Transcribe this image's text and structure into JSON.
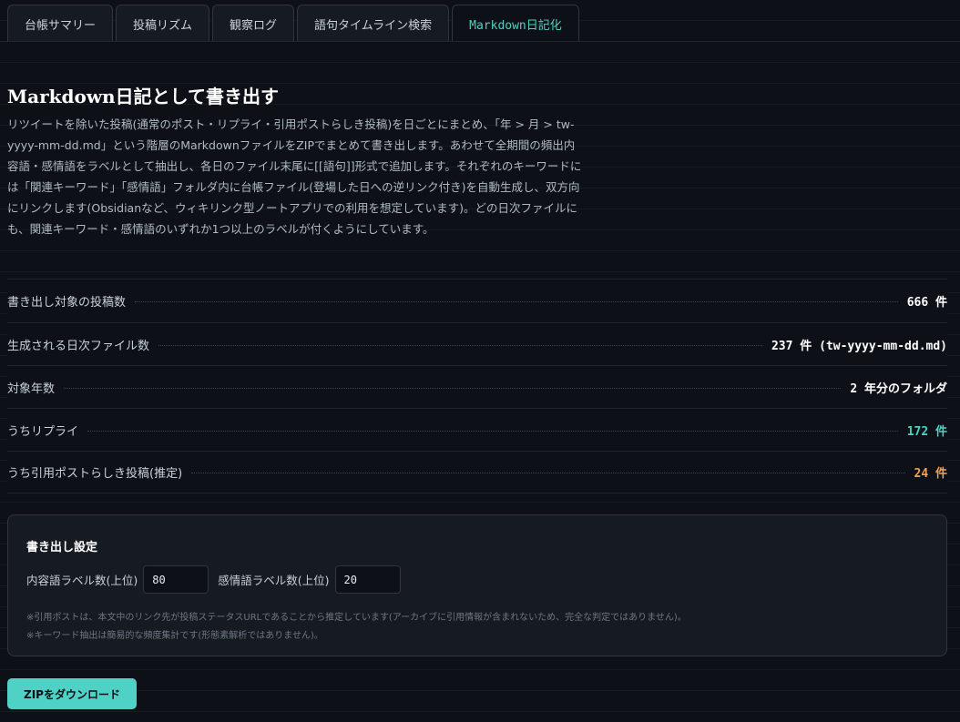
{
  "tabs": [
    {
      "label": "台帳サマリー"
    },
    {
      "label": "投稿リズム"
    },
    {
      "label": "観察ログ"
    },
    {
      "label": "語句タイムライン検索"
    },
    {
      "label": "Markdown日記化"
    }
  ],
  "active_tab": 4,
  "main": {
    "title": "Markdown日記として書き出す",
    "description": "リツイートを除いた投稿(通常のポスト・リプライ・引用ポストらしき投稿)を日ごとにまとめ、「年 > 月 > tw-yyyy-mm-dd.md」という階層のMarkdownファイルをZIPでまとめて書き出します。あわせて全期間の頻出内容語・感情語をラベルとして抽出し、各日のファイル末尾に[[語句]]形式で追加します。それぞれのキーワードには「関連キーワード」「感情語」フォルダ内に台帳ファイル(登場した日への逆リンク付き)を自動生成し、双方向にリンクします(Obsidianなど、ウィキリンク型ノートアプリでの利用を想定しています)。どの日次ファイルにも、関連キーワード・感情語のいずれか1つ以上のラベルが付くようにしています。"
  },
  "stats": [
    {
      "label": "書き出し対象の投稿数",
      "value": "666 件",
      "color": "#ffffff"
    },
    {
      "label": "生成される日次ファイル数",
      "value": "237 件 (tw-yyyy-mm-dd.md)",
      "color": "#ffffff"
    },
    {
      "label": "対象年数",
      "value": "2 年分のフォルダ",
      "color": "#ffffff"
    },
    {
      "label": "うちリプライ",
      "value": "172 件",
      "color": "#4fd1c5"
    },
    {
      "label": "うち引用ポストらしき投稿(推定)",
      "value": "24 件",
      "color": "#f0a257"
    }
  ],
  "settings": {
    "title": "書き出し設定",
    "content_label": "内容語ラベル数(上位)",
    "content_value": "80",
    "emotion_label": "感情語ラベル数(上位)",
    "emotion_value": "20",
    "note1": "※引用ポストは、本文中のリンク先が投稿ステータスURLであることから推定しています(アーカイブに引用情報が含まれないため、完全な判定ではありません)。",
    "note2": "※キーワード抽出は簡易的な頻度集計です(形態素解析ではありません)。"
  },
  "download_label": "ZIPをダウンロード",
  "colors": {
    "accent": "#4fd1c5",
    "warning": "#f0a257",
    "background": "#0d1117"
  }
}
